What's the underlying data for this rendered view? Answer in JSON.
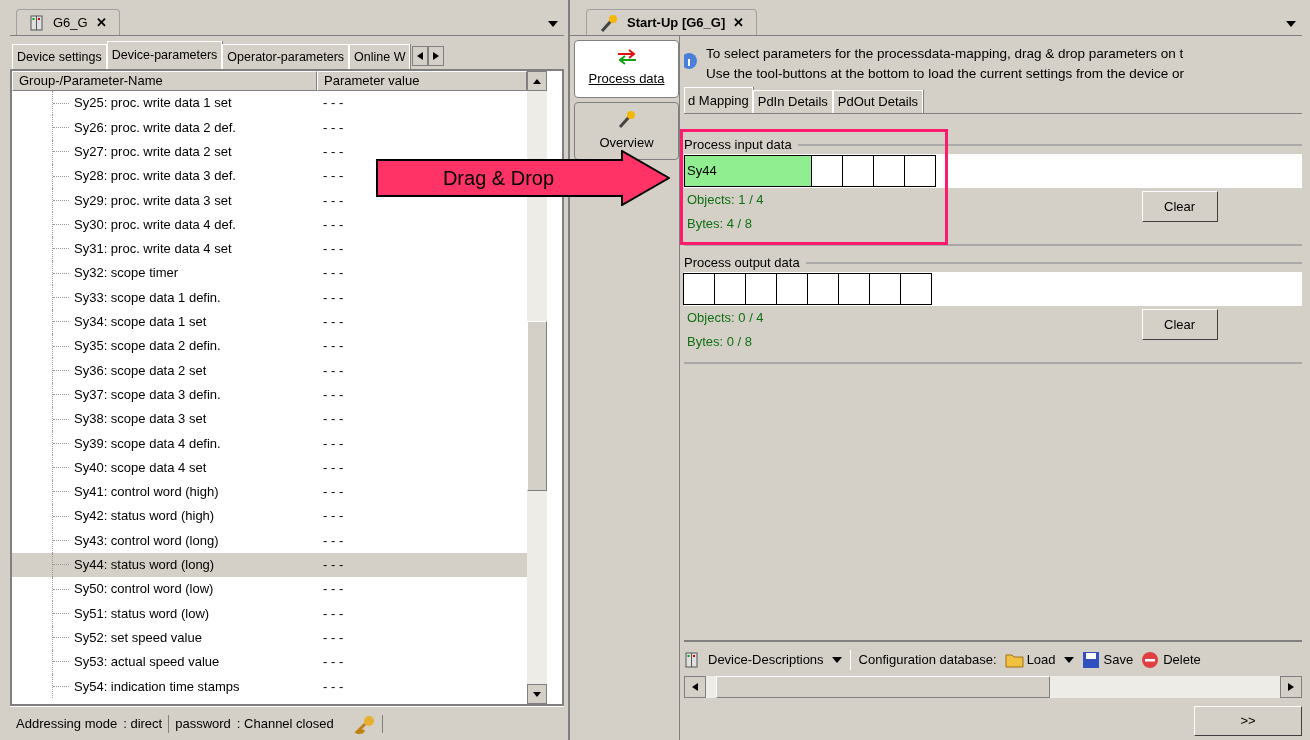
{
  "left_panel": {
    "doc_tab": {
      "title": "G6_G",
      "close": "✕"
    },
    "tabs": [
      {
        "label": "Device settings",
        "selected": false
      },
      {
        "label": "Device-parameters",
        "selected": true
      },
      {
        "label": "Operator-parameters",
        "selected": false
      },
      {
        "label": "Online W",
        "selected": false
      }
    ],
    "table": {
      "columns": [
        "Group-/Parameter-Name",
        "Parameter value"
      ],
      "rows": [
        {
          "name": "Sy25: proc. write data 1 set",
          "value": "- - -",
          "selected": false
        },
        {
          "name": "Sy26: proc. write data 2 def.",
          "value": "- - -",
          "selected": false
        },
        {
          "name": "Sy27: proc. write data 2 set",
          "value": "- - -",
          "selected": false
        },
        {
          "name": "Sy28: proc. write data 3 def.",
          "value": "- - -",
          "selected": false
        },
        {
          "name": "Sy29: proc. write data 3 set",
          "value": "- - -",
          "selected": false
        },
        {
          "name": "Sy30: proc. write data 4 def.",
          "value": "- - -",
          "selected": false
        },
        {
          "name": "Sy31: proc. write data 4 set",
          "value": "- - -",
          "selected": false
        },
        {
          "name": "Sy32: scope timer",
          "value": "- - -",
          "selected": false
        },
        {
          "name": "Sy33: scope data 1 defin.",
          "value": "- - -",
          "selected": false
        },
        {
          "name": "Sy34: scope data 1 set",
          "value": "- - -",
          "selected": false
        },
        {
          "name": "Sy35: scope data 2 defin.",
          "value": "- - -",
          "selected": false
        },
        {
          "name": "Sy36: scope data 2 set",
          "value": "- - -",
          "selected": false
        },
        {
          "name": "Sy37: scope data 3 defin.",
          "value": "- - -",
          "selected": false
        },
        {
          "name": "Sy38: scope data 3 set",
          "value": "- - -",
          "selected": false
        },
        {
          "name": "Sy39: scope data 4 defin.",
          "value": "- - -",
          "selected": false
        },
        {
          "name": "Sy40: scope data 4 set",
          "value": "- - -",
          "selected": false
        },
        {
          "name": "Sy41: control word (high)",
          "value": "- - -",
          "selected": false
        },
        {
          "name": "Sy42: status word (high)",
          "value": "- - -",
          "selected": false
        },
        {
          "name": "Sy43: control word (long)",
          "value": "- - -",
          "selected": false
        },
        {
          "name": "Sy44: status word (long)",
          "value": "- - -",
          "selected": true
        },
        {
          "name": "Sy50: control word (low)",
          "value": "- - -",
          "selected": false
        },
        {
          "name": "Sy51: status word (low)",
          "value": "- - -",
          "selected": false
        },
        {
          "name": "Sy52: set speed value",
          "value": "- - -",
          "selected": false
        },
        {
          "name": "Sy53: actual speed value",
          "value": "- - -",
          "selected": false
        },
        {
          "name": "Sy54: indication time stamps",
          "value": "- - -",
          "selected": false
        }
      ]
    },
    "status_bar": {
      "addressing_label": "Addressing mode",
      "addressing_value": ": direct",
      "password_label": "password",
      "password_value": ": Channel closed"
    }
  },
  "right_panel": {
    "doc_tab": {
      "title": "Start-Up [G6_G]",
      "close": "✕"
    },
    "sidebar": [
      {
        "label": "Process data",
        "selected": true,
        "kind": "arrows"
      },
      {
        "label": "Overview",
        "selected": false,
        "kind": "wand"
      }
    ],
    "info_lines": [
      "To select parameters for the processdata-mapping, drag & drop parameters on t",
      "Use the tool-buttons at the bottom to load the current settings from the device or"
    ],
    "tabs": [
      {
        "label": "d Mapping",
        "selected": true
      },
      {
        "label": "PdIn Details",
        "selected": false
      },
      {
        "label": "PdOut Details",
        "selected": false
      }
    ],
    "groups": [
      {
        "title": "Process input data",
        "slots": [
          {
            "label": "Sy44",
            "filled": true
          },
          {
            "filled": false
          },
          {
            "filled": false
          },
          {
            "filled": false
          },
          {
            "filled": false
          }
        ],
        "objects": "Objects: 1 / 4",
        "bytes": "Bytes: 4 / 8",
        "button": "Clear"
      },
      {
        "title": "Process output data",
        "slots": [
          {
            "filled": false
          },
          {
            "filled": false
          },
          {
            "filled": false
          },
          {
            "filled": false
          },
          {
            "filled": false
          },
          {
            "filled": false
          },
          {
            "filled": false
          },
          {
            "filled": false
          }
        ],
        "objects": "Objects: 0 / 4",
        "bytes": "Bytes: 0 / 8",
        "button": "Clear"
      }
    ],
    "toolbar": {
      "device_descriptions": "Device-Descriptions",
      "config_label": "Configuration database:",
      "load": "Load",
      "save": "Save",
      "delete": "Delete"
    },
    "next_button": ">>"
  },
  "annotation": {
    "label": "Drag & Drop"
  }
}
